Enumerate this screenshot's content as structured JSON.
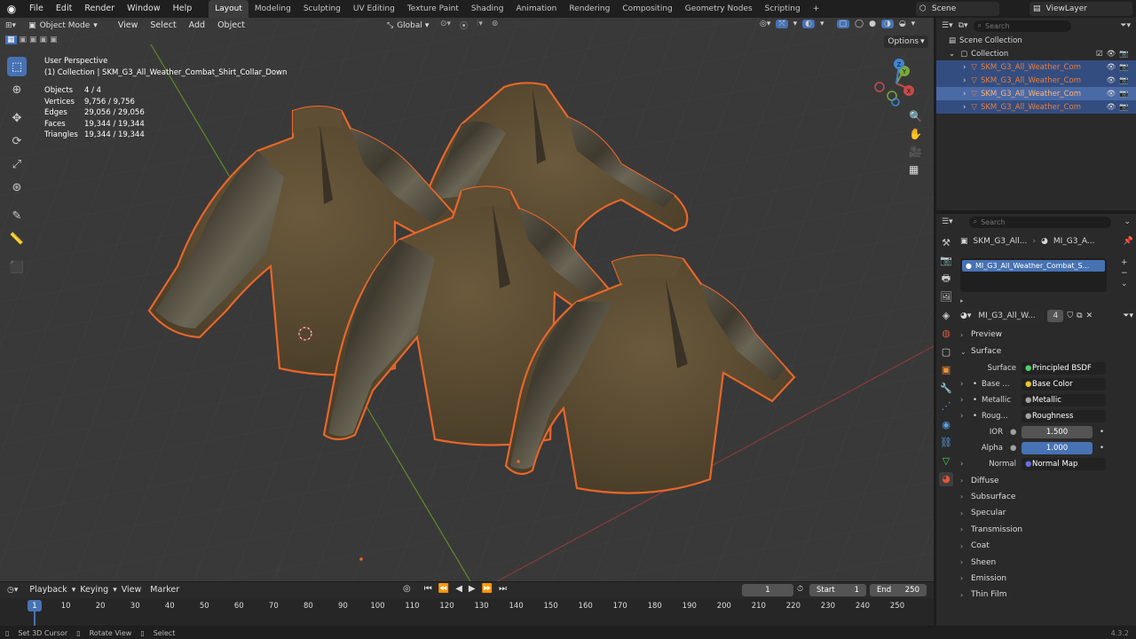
{
  "app": {
    "menus": [
      "File",
      "Edit",
      "Render",
      "Window",
      "Help"
    ],
    "workspaces": [
      "Layout",
      "Modeling",
      "Sculpting",
      "UV Editing",
      "Texture Paint",
      "Shading",
      "Animation",
      "Rendering",
      "Compositing",
      "Geometry Nodes",
      "Scripting"
    ],
    "add_tab": "+",
    "scene": "Scene",
    "view_layer": "ViewLayer",
    "version": "4.3.2"
  },
  "viewport": {
    "mode": "Object Mode",
    "menus": [
      "View",
      "Select",
      "Add",
      "Object"
    ],
    "transform": "Global",
    "options": "Options",
    "title": "User Perspective",
    "collection_line": "(1) Collection | SKM_G3_All_Weather_Combat_Shirt_Collar_Down",
    "stats": [
      {
        "label": "Objects",
        "value": "4 / 4"
      },
      {
        "label": "Vertices",
        "value": "9,756 / 9,756"
      },
      {
        "label": "Edges",
        "value": "29,056 / 29,056"
      },
      {
        "label": "Faces",
        "value": "19,344 / 19,344"
      },
      {
        "label": "Triangles",
        "value": "19,344 / 19,344"
      }
    ],
    "gizmo": {
      "x": "X",
      "y": "Y",
      "z": "Z"
    }
  },
  "outliner": {
    "search_placeholder": "Search",
    "scene_collection": "Scene Collection",
    "collection": "Collection",
    "items": [
      "SKM_G3_All_Weather_Com",
      "SKM_G3_All_Weather_Com",
      "SKM_G3_All_Weather_Com",
      "SKM_G3_All_Weather_Com"
    ],
    "colors": {
      "selected_bg": "#334d80",
      "object_text": "#e87d3e"
    }
  },
  "properties": {
    "search_placeholder": "Search",
    "breadcrumb_object": "SKM_G3_All...",
    "breadcrumb_material": "MI_G3_A...",
    "material_slot": "MI_G3_All_Weather_Combat_S...",
    "material_name": "MI_G3_All_W...",
    "user_count": "4",
    "sections": {
      "preview": "Preview",
      "surface": "Surface"
    },
    "surface_label": "Surface",
    "surface_value": "Principled BSDF",
    "inputs": [
      {
        "label": "Base ...",
        "value": "Base Color",
        "dot": "#e5c52e"
      },
      {
        "label": "Metallic",
        "value": "Metallic",
        "dot": "#a1a1a1"
      },
      {
        "label": "Roug...",
        "value": "Roughness",
        "dot": "#a1a1a1"
      }
    ],
    "ior_label": "IOR",
    "ior_value": "1.500",
    "alpha_label": "Alpha",
    "alpha_value": "1.000",
    "normal_label": "Normal",
    "normal_value": "Normal Map",
    "subsections": [
      "Diffuse",
      "Subsurface",
      "Specular",
      "Transmission",
      "Coat",
      "Sheen",
      "Emission",
      "Thin Film"
    ]
  },
  "timeline": {
    "menus": [
      "Playback",
      "Keying",
      "View",
      "Marker"
    ],
    "current_frame": "1",
    "start_label": "Start",
    "start": "1",
    "end_label": "End",
    "end": "250",
    "ticks": [
      "1",
      "10",
      "20",
      "30",
      "40",
      "50",
      "60",
      "70",
      "80",
      "90",
      "100",
      "110",
      "120",
      "130",
      "140",
      "150",
      "160",
      "170",
      "180",
      "190",
      "200",
      "210",
      "220",
      "230",
      "240",
      "250"
    ]
  },
  "status": {
    "items": [
      "Set 3D Cursor",
      "Rotate View",
      "Select"
    ]
  }
}
